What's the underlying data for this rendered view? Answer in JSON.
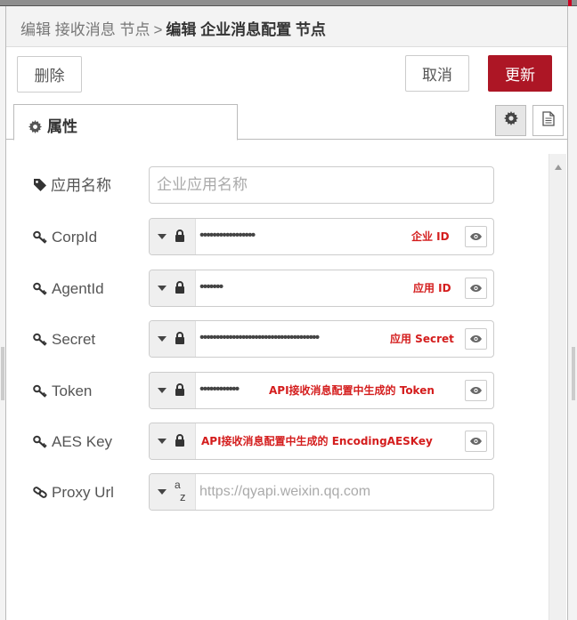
{
  "breadcrumb": {
    "parent": "编辑 接收消息 节点",
    "separator": ">",
    "current": "编辑 企业消息配置 节点"
  },
  "toolbar": {
    "delete_label": "删除",
    "cancel_label": "取消",
    "update_label": "更新"
  },
  "tabs": {
    "properties_label": "属性"
  },
  "form": {
    "app_name": {
      "label": "应用名称",
      "value": "",
      "placeholder": "企业应用名称"
    },
    "corp_id": {
      "label": "CorpId",
      "masked": "•••••••••••••••••",
      "note": "企业 ID"
    },
    "agent_id": {
      "label": "AgentId",
      "masked": "•••••••",
      "note": "应用 ID"
    },
    "secret": {
      "label": "Secret",
      "masked": "•••••••••••••••••••••••••••••••••••••",
      "note": "应用 Secret"
    },
    "token": {
      "label": "Token",
      "masked": "••••••••••••",
      "note": "API接收消息配置中生成的 Token"
    },
    "aes_key": {
      "label": "AES Key",
      "masked": "",
      "note": "API接收消息配置中生成的 EncodingAESKey"
    },
    "proxy_url": {
      "label": "Proxy Url",
      "value": "",
      "placeholder": "https://qyapi.weixin.qq.com",
      "type_top": "a",
      "type_bottom": "z"
    }
  },
  "colors": {
    "accent": "#ad1625",
    "note_red": "#d41d1d"
  }
}
